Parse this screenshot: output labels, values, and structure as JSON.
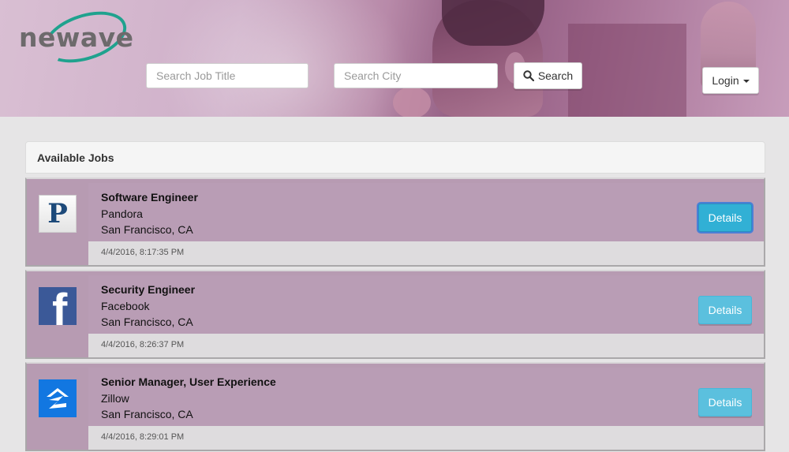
{
  "header": {
    "logo_text": "newave",
    "search": {
      "job_title_placeholder": "Search Job Title",
      "city_placeholder": "Search City",
      "button_label": "Search"
    },
    "login_label": "Login"
  },
  "panel": {
    "heading": "Available Jobs"
  },
  "jobs": [
    {
      "title": "Software Engineer",
      "company": "Pandora",
      "location": "San Francisco, CA",
      "posted": "4/4/2016, 8:17:35 PM",
      "details_label": "Details",
      "logo_icon": "pandora-logo-icon",
      "logo_text": "P"
    },
    {
      "title": "Security Engineer",
      "company": "Facebook",
      "location": "San Francisco, CA",
      "posted": "4/4/2016, 8:26:37 PM",
      "details_label": "Details",
      "logo_icon": "facebook-logo-icon",
      "logo_text": "f"
    },
    {
      "title": "Senior Manager, User Experience",
      "company": "Zillow",
      "location": "San Francisco, CA",
      "posted": "4/4/2016, 8:29:01 PM",
      "details_label": "Details",
      "logo_icon": "zillow-logo-icon"
    }
  ],
  "colors": {
    "card_bg": "#b99db5",
    "details_button": "#5bc0de",
    "brand_teal": "#1fa28e"
  }
}
